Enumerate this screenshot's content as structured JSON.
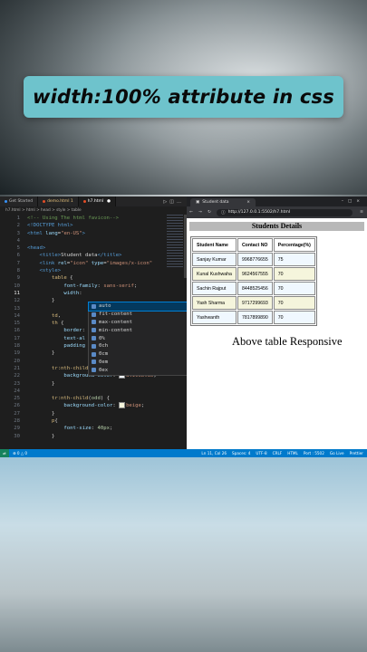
{
  "banner": {
    "title": "width:100% attribute in css"
  },
  "editor": {
    "tabs": [
      {
        "label": "Get Started"
      },
      {
        "label": "demo.html 1"
      },
      {
        "label": "h7.html"
      }
    ],
    "breadcrumb": "h7.html > html > head > style > table",
    "lines": [
      {
        "n": "1",
        "parts": [
          [
            "c-com",
            "<!-- Using The html favicon-->"
          ]
        ]
      },
      {
        "n": "2",
        "parts": [
          [
            "c-tag",
            "<!DOCTYPE html>"
          ]
        ]
      },
      {
        "n": "3",
        "parts": [
          [
            "c-tag",
            "<html "
          ],
          [
            "c-attr",
            "lang"
          ],
          [
            "c-pun",
            "="
          ],
          [
            "c-str",
            "\"en-US\""
          ],
          [
            "c-tag",
            ">"
          ]
        ]
      },
      {
        "n": "4",
        "parts": []
      },
      {
        "n": "5",
        "parts": [
          [
            "c-tag",
            "<head>"
          ]
        ]
      },
      {
        "n": "6",
        "parts": [
          [
            "c-pun",
            "    "
          ],
          [
            "c-tag",
            "<title>"
          ],
          [
            "txt",
            "Student data"
          ],
          [
            "c-tag",
            "</title>"
          ]
        ]
      },
      {
        "n": "7",
        "parts": [
          [
            "c-pun",
            "    "
          ],
          [
            "c-tag",
            "<link "
          ],
          [
            "c-attr",
            "rel"
          ],
          [
            "c-pun",
            "="
          ],
          [
            "c-str",
            "\"icon\" "
          ],
          [
            "c-attr",
            "type"
          ],
          [
            "c-pun",
            "="
          ],
          [
            "c-str",
            "\"images/x-icon\""
          ]
        ]
      },
      {
        "n": "8",
        "parts": [
          [
            "c-pun",
            "    "
          ],
          [
            "c-tag",
            "<style>"
          ]
        ]
      },
      {
        "n": "9",
        "parts": [
          [
            "c-pun",
            "        "
          ],
          [
            "c-sel",
            "table "
          ],
          [
            "c-pun",
            "{"
          ]
        ]
      },
      {
        "n": "10",
        "parts": [
          [
            "c-pun",
            "            "
          ],
          [
            "c-prop",
            "font-family"
          ],
          [
            "c-pun",
            ": "
          ],
          [
            "c-val",
            "sans-serif"
          ],
          [
            "c-pun",
            ";"
          ]
        ]
      },
      {
        "n": "11",
        "parts": [
          [
            "c-pun",
            "            "
          ],
          [
            "c-prop",
            "width"
          ],
          [
            "c-pun",
            ": "
          ]
        ]
      },
      {
        "n": "12",
        "parts": [
          [
            "c-pun",
            "        }"
          ]
        ]
      },
      {
        "n": "13",
        "parts": []
      },
      {
        "n": "14",
        "parts": [
          [
            "c-pun",
            "        "
          ],
          [
            "c-sel",
            "td"
          ],
          [
            "c-pun",
            ","
          ]
        ]
      },
      {
        "n": "15",
        "parts": [
          [
            "c-pun",
            "        "
          ],
          [
            "c-sel",
            "th "
          ],
          [
            "c-pun",
            "{"
          ]
        ]
      },
      {
        "n": "16",
        "parts": [
          [
            "c-pun",
            "            "
          ],
          [
            "c-prop",
            "border"
          ],
          [
            "c-pun",
            ":"
          ]
        ]
      },
      {
        "n": "17",
        "parts": [
          [
            "c-pun",
            "            "
          ],
          [
            "c-prop",
            "text-al"
          ]
        ]
      },
      {
        "n": "18",
        "parts": [
          [
            "c-pun",
            "            "
          ],
          [
            "c-prop",
            "padding"
          ]
        ]
      },
      {
        "n": "19",
        "parts": [
          [
            "c-pun",
            "        }"
          ]
        ]
      },
      {
        "n": "20",
        "parts": []
      },
      {
        "n": "21",
        "parts": [
          [
            "c-pun",
            "        "
          ],
          [
            "c-sel",
            "tr:nth-child"
          ],
          [
            "c-pun",
            "("
          ],
          [
            "c-num",
            "even"
          ],
          [
            "c-pun",
            ") {"
          ]
        ]
      },
      {
        "n": "22",
        "parts": [
          [
            "c-pun",
            "            "
          ],
          [
            "c-prop",
            "background-color"
          ],
          [
            "c-pun",
            ": "
          ],
          [
            "swatch",
            "#f0f8ff"
          ],
          [
            "c-val",
            "aliceblue"
          ],
          [
            "c-pun",
            ";"
          ]
        ]
      },
      {
        "n": "23",
        "parts": [
          [
            "c-pun",
            "        }"
          ]
        ]
      },
      {
        "n": "24",
        "parts": []
      },
      {
        "n": "25",
        "parts": [
          [
            "c-pun",
            "        "
          ],
          [
            "c-sel",
            "tr:nth-child"
          ],
          [
            "c-pun",
            "("
          ],
          [
            "c-num",
            "odd"
          ],
          [
            "c-pun",
            ") {"
          ]
        ]
      },
      {
        "n": "26",
        "parts": [
          [
            "c-pun",
            "            "
          ],
          [
            "c-prop",
            "background-color"
          ],
          [
            "c-pun",
            ": "
          ],
          [
            "swatch",
            "#f5f5dc"
          ],
          [
            "c-val",
            "beige"
          ],
          [
            "c-pun",
            ";"
          ]
        ]
      },
      {
        "n": "27",
        "parts": [
          [
            "c-pun",
            "        }"
          ]
        ]
      },
      {
        "n": "28",
        "parts": [
          [
            "c-pun",
            "        "
          ],
          [
            "c-sel",
            "p"
          ],
          [
            "c-pun",
            "{"
          ]
        ]
      },
      {
        "n": "29",
        "parts": [
          [
            "c-pun",
            "            "
          ],
          [
            "c-prop",
            "font-size"
          ],
          [
            "c-pun",
            ": "
          ],
          [
            "c-num",
            "40px"
          ],
          [
            "c-pun",
            ";"
          ]
        ]
      },
      {
        "n": "30",
        "parts": [
          [
            "c-pun",
            "        }"
          ]
        ]
      }
    ],
    "current_line": "11",
    "suggestions": [
      "auto",
      "fit-content",
      "max-content",
      "min-content",
      "0%",
      "0ch",
      "0cm",
      "0em",
      "0ex"
    ],
    "status": {
      "position": "Ln 11, Col 26",
      "spaces": "Spaces: 4",
      "encoding": "UTF-8",
      "eol": "CRLF",
      "lang": "HTML",
      "port": "Port : 5502",
      "live": "Go Live",
      "prettier": "Prettier"
    }
  },
  "browser": {
    "tab_title": "Student data",
    "url": "http://127.0.0.1:5502/h7.html",
    "caption": "Students Details",
    "headers": [
      "Student Name",
      "Contact NO",
      "Percentage(%)"
    ],
    "rows": [
      [
        "Sanjay Kumar",
        "9968776655",
        "75"
      ],
      [
        "Kunal Kushwaha",
        "9624567555",
        "70"
      ],
      [
        "Sachin Rajput",
        "8448525456",
        "70"
      ],
      [
        "Yash Sharma",
        "9717299693",
        "70"
      ],
      [
        "Yashwanth",
        "7817899890",
        "70"
      ]
    ],
    "responsive_text": "Above table Responsive"
  },
  "colors": {
    "banner": "#6ec3cc",
    "statusbar": "#007acc",
    "aliceblue": "#f0f8ff",
    "beige": "#f5f5dc"
  }
}
